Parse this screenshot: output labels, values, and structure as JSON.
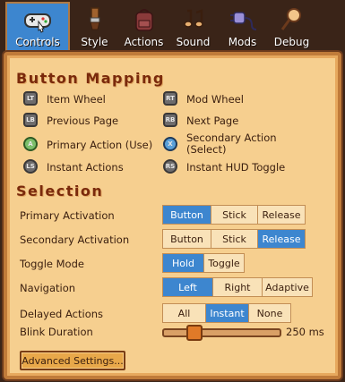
{
  "tabs": [
    {
      "label": "Controls",
      "icon": "gamepad-icon",
      "active": true
    },
    {
      "label": "Style",
      "icon": "brush-icon",
      "active": false
    },
    {
      "label": "Actions",
      "icon": "backpack-icon",
      "active": false
    },
    {
      "label": "Sound",
      "icon": "music-note-icon",
      "active": false
    },
    {
      "label": "Mods",
      "icon": "plug-icon",
      "active": false
    },
    {
      "label": "Debug",
      "icon": "bug-net-icon",
      "active": false
    }
  ],
  "button_mapping": {
    "title": "Button Mapping",
    "items": [
      {
        "label": "Item Wheel",
        "glyph": "LT"
      },
      {
        "label": "Mod Wheel",
        "glyph": "RT"
      },
      {
        "label": "Previous Page",
        "glyph": "LB"
      },
      {
        "label": "Next Page",
        "glyph": "RB"
      },
      {
        "label": "Primary Action (Use)",
        "glyph": "A"
      },
      {
        "label": "Secondary Action (Select)",
        "glyph": "X"
      },
      {
        "label": "Instant Actions",
        "glyph": "LS"
      },
      {
        "label": "Instant HUD Toggle",
        "glyph": "RS"
      }
    ]
  },
  "selection": {
    "title": "Selection",
    "primary_activation": {
      "label": "Primary Activation",
      "options": [
        "Button",
        "Stick",
        "Release"
      ],
      "selected": "Button"
    },
    "secondary_activation": {
      "label": "Secondary Activation",
      "options": [
        "Button",
        "Stick",
        "Release"
      ],
      "selected": "Release"
    },
    "toggle_mode": {
      "label": "Toggle Mode",
      "options": [
        "Hold",
        "Toggle"
      ],
      "selected": "Hold"
    },
    "navigation": {
      "label": "Navigation",
      "options": [
        "Left",
        "Right",
        "Adaptive"
      ],
      "selected": "Left"
    },
    "delayed_actions": {
      "label": "Delayed Actions",
      "options": [
        "All",
        "Instant",
        "None"
      ],
      "selected": "Instant"
    },
    "blink_duration": {
      "label": "Blink Duration",
      "value_text": "250 ms",
      "fraction": 0.22
    }
  },
  "advanced_button": "Advanced Settings..."
}
